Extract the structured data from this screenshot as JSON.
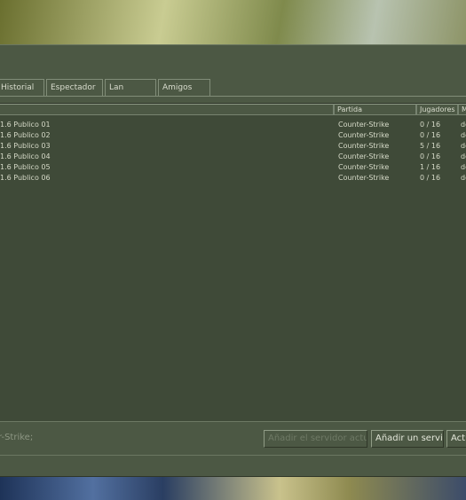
{
  "tabs": [
    "Historial",
    "Espectador",
    "Lan",
    "Amigos"
  ],
  "columns": [
    "",
    "Partida",
    "Jugadores",
    "M"
  ],
  "servers": [
    {
      "name": "1.6 Publico 01",
      "game": "Counter-Strike",
      "players": "0 / 16",
      "map": "de"
    },
    {
      "name": "1.6 Publico 02",
      "game": "Counter-Strike",
      "players": "0 / 16",
      "map": "de"
    },
    {
      "name": "1.6 Publico 03",
      "game": "Counter-Strike",
      "players": "5 / 16",
      "map": "de"
    },
    {
      "name": "1.6 Publico 04",
      "game": "Counter-Strike",
      "players": "0 / 16",
      "map": "de"
    },
    {
      "name": "1.6 Publico 05",
      "game": "Counter-Strike",
      "players": "1 / 16",
      "map": "de"
    },
    {
      "name": "1.6 Publico 06",
      "game": "Counter-Strike",
      "players": "0 / 16",
      "map": "de"
    }
  ],
  "filter": {
    "text": "r-Strike;"
  },
  "buttons": {
    "add_current": "Añadir el servidor actua",
    "add_server": "Añadir un servi.",
    "refresh": "Actu"
  }
}
